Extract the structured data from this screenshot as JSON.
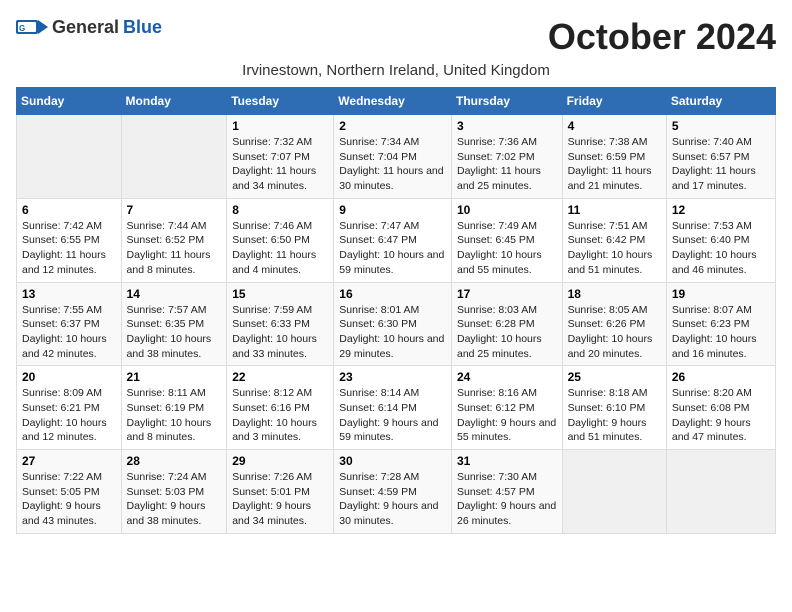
{
  "logo": {
    "general": "General",
    "blue": "Blue"
  },
  "title": "October 2024",
  "subtitle": "Irvinestown, Northern Ireland, United Kingdom",
  "days_header": [
    "Sunday",
    "Monday",
    "Tuesday",
    "Wednesday",
    "Thursday",
    "Friday",
    "Saturday"
  ],
  "weeks": [
    [
      {
        "day": "",
        "empty": true
      },
      {
        "day": "",
        "empty": true
      },
      {
        "day": "1",
        "sunrise": "7:32 AM",
        "sunset": "7:07 PM",
        "daylight": "Daylight: 11 hours and 34 minutes."
      },
      {
        "day": "2",
        "sunrise": "7:34 AM",
        "sunset": "7:04 PM",
        "daylight": "Daylight: 11 hours and 30 minutes."
      },
      {
        "day": "3",
        "sunrise": "7:36 AM",
        "sunset": "7:02 PM",
        "daylight": "Daylight: 11 hours and 25 minutes."
      },
      {
        "day": "4",
        "sunrise": "7:38 AM",
        "sunset": "6:59 PM",
        "daylight": "Daylight: 11 hours and 21 minutes."
      },
      {
        "day": "5",
        "sunrise": "7:40 AM",
        "sunset": "6:57 PM",
        "daylight": "Daylight: 11 hours and 17 minutes."
      }
    ],
    [
      {
        "day": "6",
        "sunrise": "7:42 AM",
        "sunset": "6:55 PM",
        "daylight": "Daylight: 11 hours and 12 minutes."
      },
      {
        "day": "7",
        "sunrise": "7:44 AM",
        "sunset": "6:52 PM",
        "daylight": "Daylight: 11 hours and 8 minutes."
      },
      {
        "day": "8",
        "sunrise": "7:46 AM",
        "sunset": "6:50 PM",
        "daylight": "Daylight: 11 hours and 4 minutes."
      },
      {
        "day": "9",
        "sunrise": "7:47 AM",
        "sunset": "6:47 PM",
        "daylight": "Daylight: 10 hours and 59 minutes."
      },
      {
        "day": "10",
        "sunrise": "7:49 AM",
        "sunset": "6:45 PM",
        "daylight": "Daylight: 10 hours and 55 minutes."
      },
      {
        "day": "11",
        "sunrise": "7:51 AM",
        "sunset": "6:42 PM",
        "daylight": "Daylight: 10 hours and 51 minutes."
      },
      {
        "day": "12",
        "sunrise": "7:53 AM",
        "sunset": "6:40 PM",
        "daylight": "Daylight: 10 hours and 46 minutes."
      }
    ],
    [
      {
        "day": "13",
        "sunrise": "7:55 AM",
        "sunset": "6:37 PM",
        "daylight": "Daylight: 10 hours and 42 minutes."
      },
      {
        "day": "14",
        "sunrise": "7:57 AM",
        "sunset": "6:35 PM",
        "daylight": "Daylight: 10 hours and 38 minutes."
      },
      {
        "day": "15",
        "sunrise": "7:59 AM",
        "sunset": "6:33 PM",
        "daylight": "Daylight: 10 hours and 33 minutes."
      },
      {
        "day": "16",
        "sunrise": "8:01 AM",
        "sunset": "6:30 PM",
        "daylight": "Daylight: 10 hours and 29 minutes."
      },
      {
        "day": "17",
        "sunrise": "8:03 AM",
        "sunset": "6:28 PM",
        "daylight": "Daylight: 10 hours and 25 minutes."
      },
      {
        "day": "18",
        "sunrise": "8:05 AM",
        "sunset": "6:26 PM",
        "daylight": "Daylight: 10 hours and 20 minutes."
      },
      {
        "day": "19",
        "sunrise": "8:07 AM",
        "sunset": "6:23 PM",
        "daylight": "Daylight: 10 hours and 16 minutes."
      }
    ],
    [
      {
        "day": "20",
        "sunrise": "8:09 AM",
        "sunset": "6:21 PM",
        "daylight": "Daylight: 10 hours and 12 minutes."
      },
      {
        "day": "21",
        "sunrise": "8:11 AM",
        "sunset": "6:19 PM",
        "daylight": "Daylight: 10 hours and 8 minutes."
      },
      {
        "day": "22",
        "sunrise": "8:12 AM",
        "sunset": "6:16 PM",
        "daylight": "Daylight: 10 hours and 3 minutes."
      },
      {
        "day": "23",
        "sunrise": "8:14 AM",
        "sunset": "6:14 PM",
        "daylight": "Daylight: 9 hours and 59 minutes."
      },
      {
        "day": "24",
        "sunrise": "8:16 AM",
        "sunset": "6:12 PM",
        "daylight": "Daylight: 9 hours and 55 minutes."
      },
      {
        "day": "25",
        "sunrise": "8:18 AM",
        "sunset": "6:10 PM",
        "daylight": "Daylight: 9 hours and 51 minutes."
      },
      {
        "day": "26",
        "sunrise": "8:20 AM",
        "sunset": "6:08 PM",
        "daylight": "Daylight: 9 hours and 47 minutes."
      }
    ],
    [
      {
        "day": "27",
        "sunrise": "7:22 AM",
        "sunset": "5:05 PM",
        "daylight": "Daylight: 9 hours and 43 minutes."
      },
      {
        "day": "28",
        "sunrise": "7:24 AM",
        "sunset": "5:03 PM",
        "daylight": "Daylight: 9 hours and 38 minutes."
      },
      {
        "day": "29",
        "sunrise": "7:26 AM",
        "sunset": "5:01 PM",
        "daylight": "Daylight: 9 hours and 34 minutes."
      },
      {
        "day": "30",
        "sunrise": "7:28 AM",
        "sunset": "4:59 PM",
        "daylight": "Daylight: 9 hours and 30 minutes."
      },
      {
        "day": "31",
        "sunrise": "7:30 AM",
        "sunset": "4:57 PM",
        "daylight": "Daylight: 9 hours and 26 minutes."
      },
      {
        "day": "",
        "empty": true
      },
      {
        "day": "",
        "empty": true
      }
    ]
  ]
}
